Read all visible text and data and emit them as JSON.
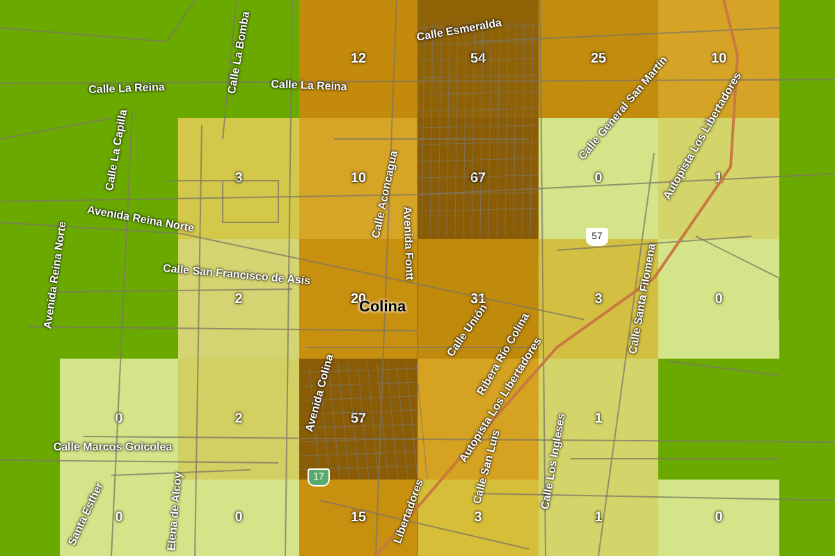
{
  "grid": {
    "rows": [
      {
        "cells": [
          null,
          null,
          null,
          {
            "count": "12",
            "color": "#c38a0c"
          },
          {
            "count": "54",
            "color": "#8f6206"
          },
          {
            "count": "25",
            "color": "#c28c0e"
          },
          {
            "count": "10",
            "color": "#d5a426"
          },
          null
        ]
      },
      {
        "cells": [
          null,
          null,
          {
            "count": "3",
            "color": "#d3c84a"
          },
          {
            "count": "10",
            "color": "#d7a526"
          },
          {
            "count": "67",
            "color": "#8a5c05"
          },
          {
            "count": "0",
            "color": "#d4e488"
          },
          {
            "count": "1",
            "color": "#d3d46a"
          },
          null
        ]
      },
      {
        "cells": [
          null,
          null,
          {
            "count": "2",
            "color": "#d4d472"
          },
          {
            "count": "20",
            "color": "#c8900f"
          },
          {
            "count": "31",
            "color": "#c08a0c"
          },
          {
            "count": "3",
            "color": "#d3c042"
          },
          {
            "count": "0",
            "color": "#d4e488"
          },
          null
        ]
      },
      {
        "cells": [
          null,
          {
            "count": "0",
            "color": "#d4e488"
          },
          {
            "count": "2",
            "color": "#d2d062"
          },
          {
            "count": "57",
            "color": "#8a5c05"
          },
          {
            "color": "#d5a222"
          },
          {
            "count": "1",
            "color": "#d3d46a"
          },
          null,
          null
        ]
      },
      {
        "cells": [
          null,
          {
            "count": "0",
            "color": "#d4e488"
          },
          {
            "count": "0",
            "color": "#d4e488"
          },
          {
            "count": "15",
            "color": "#c8900f"
          },
          {
            "count": "3",
            "color": "#d6be38"
          },
          {
            "count": "1",
            "color": "#d3d46a"
          },
          {
            "count": "0",
            "color": "#d4e488"
          },
          null
        ]
      }
    ]
  },
  "street_labels": [
    "Calle La Reina",
    "Calle La Bomba",
    "Calle La Reina",
    "Calle Esmeralda",
    "Calle General San Martín",
    "Calle La Capilla",
    "Avenida Reina Norte",
    "Calle Aconcagua",
    "Avenida Fontt",
    "Autopista Los Libertadores",
    "Avenida Reina Norte",
    "Calle San Francisco de Asís",
    "Calle Unión",
    "Ribera Río Colina",
    "Autopista Los Libertadores",
    "Calle Santa Filomena",
    "Avenida Colina",
    "Calle Marcos Goicolea",
    "Santa Esther",
    "Elena de Alcoy",
    "Calle San Luis",
    "Calle Los Ingleses",
    "Libertadores"
  ],
  "city_label": "Colina",
  "route_shields": [
    "57",
    "17"
  ]
}
